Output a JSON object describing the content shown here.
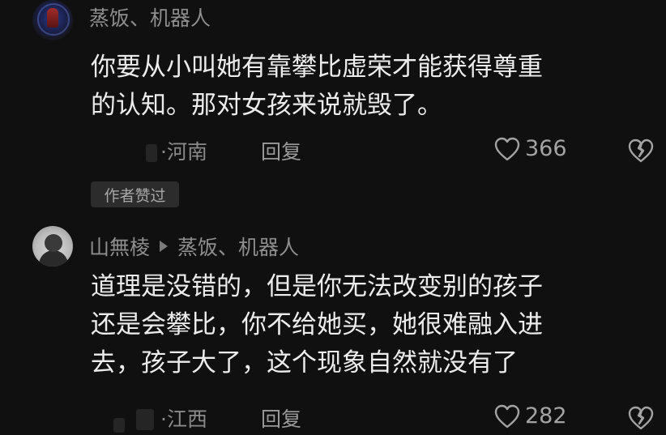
{
  "comments": [
    {
      "username": "蒸饭、机器人",
      "text_lines": [
        "你要从小叫她有靠攀比虚荣才能获得尊重",
        "的认知。那对女孩来说就毁了。"
      ],
      "location": "·河南",
      "reply_label": "回复",
      "likes": "366",
      "badge": "作者赞过"
    },
    {
      "username": "山無棱",
      "reply_to": "蒸饭、机器人",
      "text_lines": [
        "道理是没错的，但是你无法改变别的孩子",
        "还是会攀比，你不给她买，她很难融入进",
        "去，孩子大了，这个现象自然就没有了"
      ],
      "location": "·江西",
      "reply_label": "回复",
      "likes": "282"
    }
  ],
  "icons": {
    "like": "heart-outline-icon",
    "dislike": "broken-heart-icon"
  },
  "colors": {
    "background": "#101010",
    "text": "#ececec",
    "muted": "#8e8e8e"
  }
}
